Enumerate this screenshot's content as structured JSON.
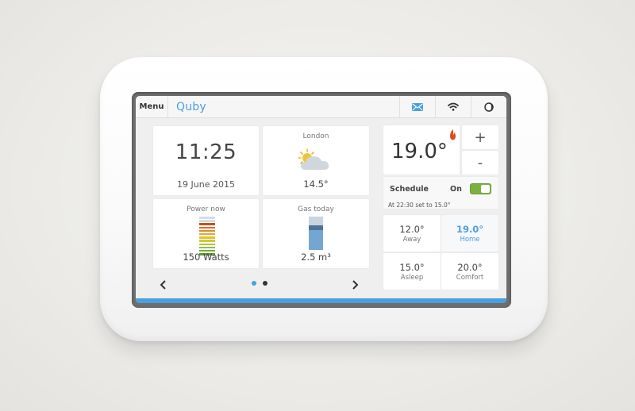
{
  "topbar": {
    "menu_label": "Menu",
    "brand": "Quby",
    "icons": [
      "mail-icon",
      "wifi-icon",
      "display-mode-icon"
    ],
    "accent_color": "#4a9fe0"
  },
  "tiles": {
    "clock": {
      "time": "11:25",
      "date": "19 June 2015"
    },
    "weather": {
      "location": "London",
      "condition": "partly-cloudy",
      "temperature": "14.5°"
    },
    "power": {
      "label": "Power now",
      "value": "150 Watts",
      "level_bars_lit": 10,
      "level_bars_total": 12
    },
    "gas": {
      "label": "Gas today",
      "value": "2.5 m³",
      "fill_fraction": 0.6
    }
  },
  "pagination": {
    "current_page": 1,
    "total_pages": 2,
    "prev_icon": "chevron-left-icon",
    "next_icon": "chevron-right-icon"
  },
  "thermostat": {
    "setpoint": "19.0°",
    "heating_active": true,
    "plus_label": "+",
    "minus_label": "-",
    "schedule": {
      "label": "Schedule",
      "state_label": "On",
      "enabled": true,
      "next_change": "At 22:30 set to 15.0°"
    },
    "presets": [
      {
        "temp": "12.0°",
        "name": "Away",
        "active": false
      },
      {
        "temp": "19.0°",
        "name": "Home",
        "active": true
      },
      {
        "temp": "15.0°",
        "name": "Asleep",
        "active": false
      },
      {
        "temp": "20.0°",
        "name": "Comfort",
        "active": false
      }
    ]
  },
  "colors": {
    "accent": "#4a9fe0",
    "toggle_on": "#7db043",
    "flame": "#e04a1f",
    "power_bars": [
      "#d2dde4",
      "#d2dde4",
      "#c0521f",
      "#d6702a",
      "#e08a2e",
      "#e3a632",
      "#e0c23a",
      "#c9cb3c",
      "#aec93f",
      "#92bf3e",
      "#78ae3a",
      "#5e9a35"
    ],
    "gas_empty": "#c9d5de",
    "gas_fill": "#74a6d2",
    "gas_marker": "#4e7398"
  }
}
